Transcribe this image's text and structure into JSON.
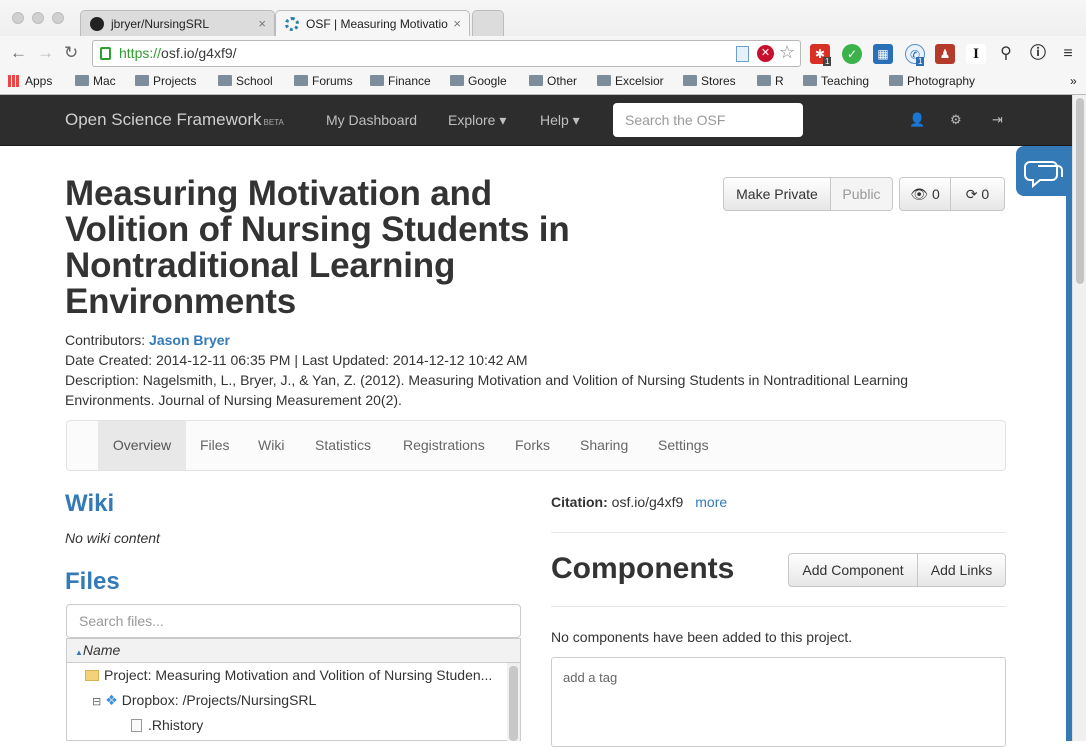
{
  "browser": {
    "tabs": [
      {
        "title": "jbryer/NursingSRL",
        "close": "×"
      },
      {
        "title": "OSF | Measuring Motivatio",
        "close": "×"
      }
    ],
    "url_scheme": "https://",
    "url_rest": "osf.io/g4xf9/",
    "bookmarks": [
      "Apps",
      "Mac",
      "Projects",
      "School",
      "Forums",
      "Finance",
      "Google",
      "Other",
      "Excelsior",
      "Stores",
      "R",
      "Teaching",
      "Photography"
    ],
    "bookmarks_overflow": "»",
    "ext_badges": {
      "a": "1",
      "b": "1"
    },
    "ext_i": "I"
  },
  "osf_nav": {
    "brand": "Open Science Framework",
    "brand_tag": "BETA",
    "dashboard": "My Dashboard",
    "explore": "Explore ▾",
    "help": "Help ▾",
    "search_placeholder": "Search the OSF"
  },
  "project": {
    "title": "Measuring Motivation and Volition of Nursing Students in Nontraditional Learning Environments",
    "make_private": "Make Private",
    "public": "Public",
    "watch_count": "0",
    "fork_count": "0",
    "contributors_label": "Contributors: ",
    "contributor": "Jason Bryer",
    "dates": "Date Created: 2014-12-11 06:35 PM | Last Updated: 2014-12-12 10:42 AM",
    "description": "Description: Nagelsmith, L., Bryer, J., & Yan, Z. (2012). Measuring Motivation and Volition of Nursing Students in Nontraditional Learning Environments. Journal of Nursing Measurement 20(2)."
  },
  "tabs": [
    "Overview",
    "Files",
    "Wiki",
    "Statistics",
    "Registrations",
    "Forks",
    "Sharing",
    "Settings"
  ],
  "wiki": {
    "heading": "Wiki",
    "empty": "No wiki content"
  },
  "files": {
    "heading": "Files",
    "search_placeholder": "Search files...",
    "col_name": "Name",
    "rows": [
      "Project: Measuring Motivation and Volition of Nursing Studen...",
      "Dropbox: /Projects/NursingSRL",
      ".Rhistory"
    ]
  },
  "citation": {
    "label": "Citation:",
    "value": "osf.io/g4xf9",
    "more": "more"
  },
  "components": {
    "heading": "Components",
    "add_component": "Add Component",
    "add_links": "Add Links",
    "empty": "No components have been added to this project.",
    "tag_placeholder": "add a tag"
  }
}
